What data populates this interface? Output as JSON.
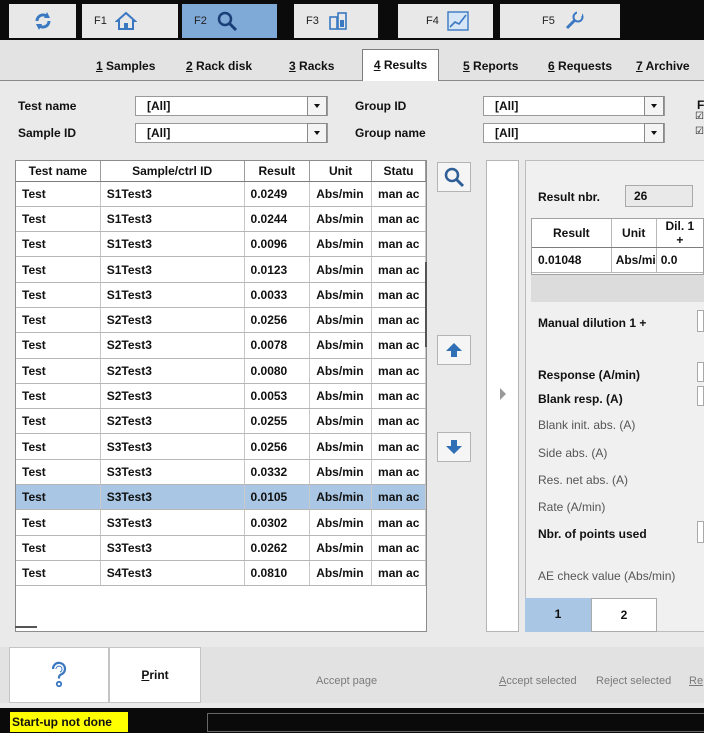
{
  "toolbar": {
    "keys": [
      {
        "label": "",
        "icon": "refresh-icon"
      },
      {
        "label": "F1",
        "icon": "home-icon"
      },
      {
        "label": "F2",
        "icon": "search-icon"
      },
      {
        "label": "F3",
        "icon": "reagent-bottle-icon"
      },
      {
        "label": "F4",
        "icon": "graph-icon"
      },
      {
        "label": "F5",
        "icon": "wrench-icon"
      }
    ],
    "active_key": "F2"
  },
  "tabs": [
    {
      "num": "1",
      "rest": " Samples"
    },
    {
      "num": "2",
      "rest": " Rack disk"
    },
    {
      "num": "3",
      "rest": " Racks"
    },
    {
      "num": "4",
      "rest": " Results"
    },
    {
      "num": "5",
      "rest": " Reports"
    },
    {
      "num": "6",
      "rest": " Requests"
    },
    {
      "num": "7",
      "rest": " Archive"
    }
  ],
  "filters": {
    "test_name_label": "Test name",
    "test_name_value": "[All]",
    "sample_id_label": "Sample ID",
    "sample_id_value": "[All]",
    "group_id_label": "Group ID",
    "group_id_value": "[All]",
    "group_name_label": "Group name",
    "group_name_value": "[All]",
    "right_cut_label": "F",
    "right_cut_check1": "☑",
    "right_cut_check2": "☑"
  },
  "results_table": {
    "headers": [
      "Test name",
      "Sample/ctrl ID",
      "Result",
      "Unit",
      "Statu"
    ],
    "rows": [
      [
        "Test",
        "S1Test3",
        "0.0249",
        "Abs/min",
        "man ac"
      ],
      [
        "Test",
        "S1Test3",
        "0.0244",
        "Abs/min",
        "man ac"
      ],
      [
        "Test",
        "S1Test3",
        "0.0096",
        "Abs/min",
        "man ac"
      ],
      [
        "Test",
        "S1Test3",
        "0.0123",
        "Abs/min",
        "man ac"
      ],
      [
        "Test",
        "S1Test3",
        "0.0033",
        "Abs/min",
        "man ac"
      ],
      [
        "Test",
        "S2Test3",
        "0.0256",
        "Abs/min",
        "man ac"
      ],
      [
        "Test",
        "S2Test3",
        "0.0078",
        "Abs/min",
        "man ac"
      ],
      [
        "Test",
        "S2Test3",
        "0.0080",
        "Abs/min",
        "man ac"
      ],
      [
        "Test",
        "S2Test3",
        "0.0053",
        "Abs/min",
        "man ac"
      ],
      [
        "Test",
        "S2Test3",
        "0.0255",
        "Abs/min",
        "man ac"
      ],
      [
        "Test",
        "S3Test3",
        "0.0256",
        "Abs/min",
        "man ac"
      ],
      [
        "Test",
        "S3Test3",
        "0.0332",
        "Abs/min",
        "man ac"
      ],
      [
        "Test",
        "S3Test3",
        "0.0105",
        "Abs/min",
        "man ac"
      ],
      [
        "Test",
        "S3Test3",
        "0.0302",
        "Abs/min",
        "man ac"
      ],
      [
        "Test",
        "S3Test3",
        "0.0262",
        "Abs/min",
        "man ac"
      ],
      [
        "Test",
        "S4Test3",
        "0.0810",
        "Abs/min",
        "man ac"
      ]
    ],
    "selected_row": 12
  },
  "detail": {
    "result_nbr_label": "Result nbr.",
    "result_nbr_value": "26",
    "sub_headers": [
      "Result",
      "Unit",
      "Dil. 1 +"
    ],
    "sub_row": [
      "0.01048",
      "Abs/mi",
      "0.0"
    ],
    "manual_dilution_label": "Manual dilution 1 +",
    "response_label": "Response (A/min)",
    "blank_resp_label": "Blank resp. (A)",
    "blank_init_label": "Blank init. abs. (A)",
    "side_abs_label": "Side abs. (A)",
    "res_net_label": "Res. net abs. (A)",
    "rate_label": "Rate (A/min)",
    "nbr_points_label": "Nbr. of points used",
    "ae_check_label": "AE check value (Abs/min)",
    "pages": [
      "1",
      "2"
    ]
  },
  "actions": {
    "print_p": "P",
    "print_rest": "rint",
    "accept_page_pre": "Accept pa",
    "accept_page_u": "g",
    "accept_page_post": "e",
    "accept_selected_pre": "",
    "accept_selected_u": "A",
    "accept_selected_post": "ccept selected",
    "reject_selected_pre": "Re",
    "reject_selected_u": "j",
    "reject_selected_post": "ect selected",
    "cut_off_button": "Re"
  },
  "status": {
    "startup_text": "Start-up not done"
  },
  "colors": {
    "selected_row": "#a9c6e4",
    "active_fkey": "#7fa9d6",
    "warning_badge": "#ffff00"
  }
}
